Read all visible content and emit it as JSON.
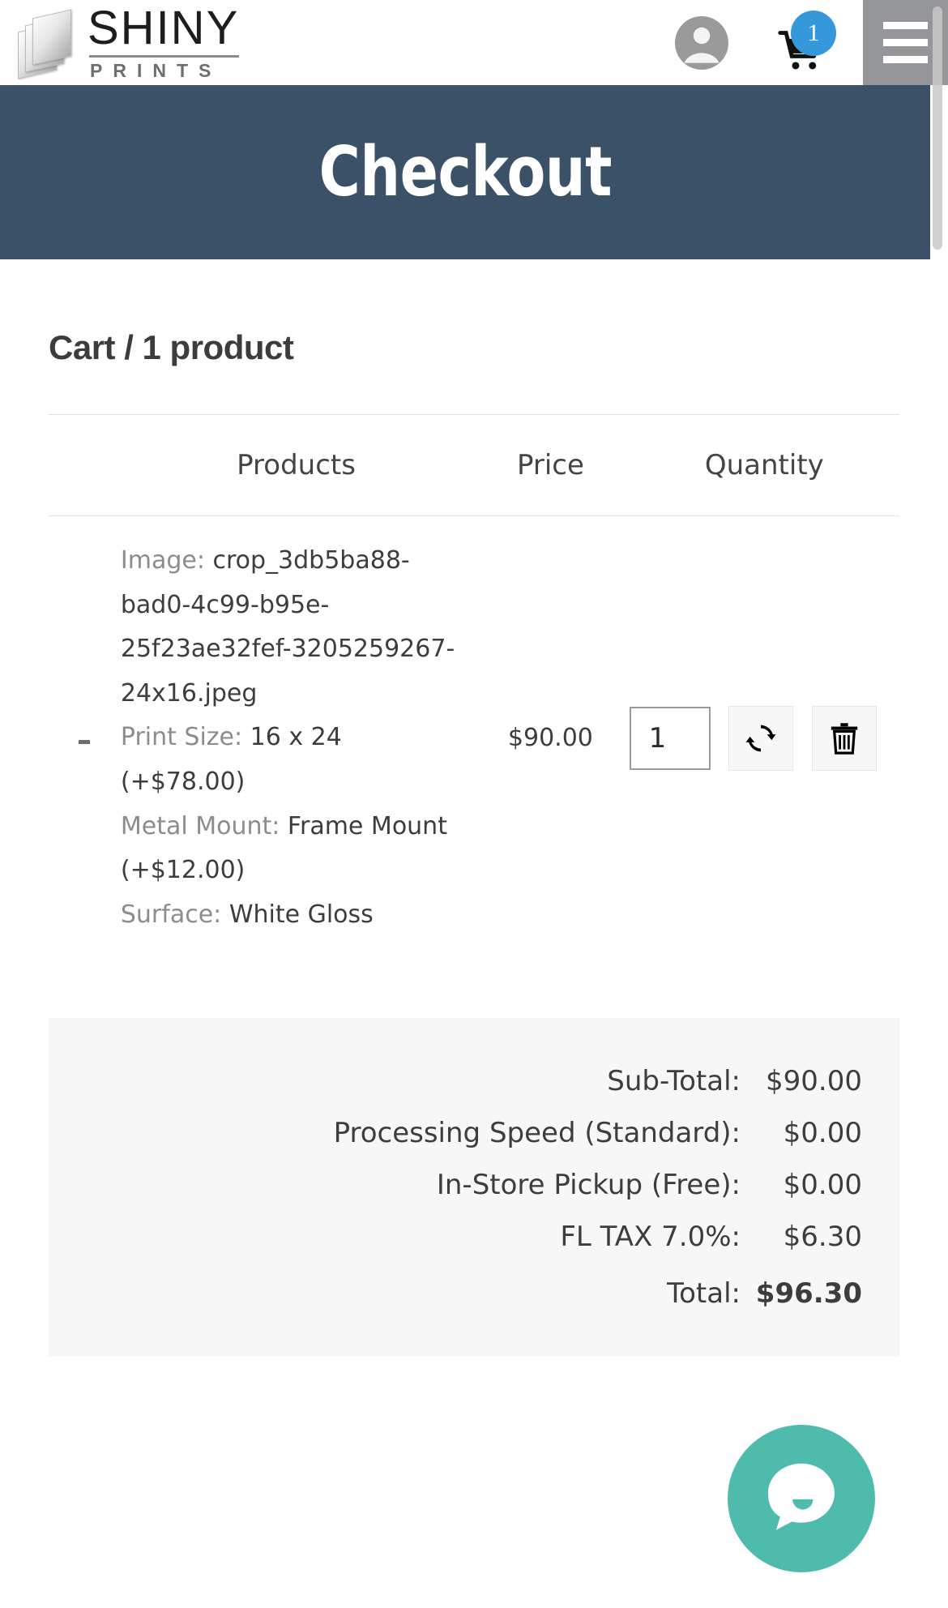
{
  "header": {
    "logo": {
      "primary": "SHINY",
      "secondary": "PRINTS",
      "icon": "stacked-prints-logo"
    },
    "account_icon": "account-circle-icon",
    "cart_icon": "shopping-cart-icon",
    "cart_count": "1",
    "menu_icon": "hamburger-menu-icon",
    "accent_badge_color": "#3498db",
    "menu_button_color": "#949699"
  },
  "banner": {
    "title": "Checkout",
    "background_color": "#3a5168"
  },
  "cart": {
    "heading": "Cart / 1 product",
    "columns": {
      "thumb": "",
      "products": "Products",
      "price": "Price",
      "quantity": "Quantity"
    },
    "items": [
      {
        "thumbnail_placeholder": "-",
        "attributes": [
          {
            "label": "Image:",
            "value": "crop_3db5ba88-bad0-4c99-b95e-25f23ae32fef-3205259267-24x16.jpeg"
          },
          {
            "label": "Print Size:",
            "value": "16 x 24 (+$78.00)"
          },
          {
            "label": "Metal Mount:",
            "value": "Frame Mount (+$12.00)"
          },
          {
            "label": "Surface:",
            "value": "White Gloss"
          }
        ],
        "price": "$90.00",
        "quantity": "1",
        "update_icon": "refresh-icon",
        "remove_icon": "trash-icon"
      }
    ]
  },
  "totals": {
    "rows": [
      {
        "label": "Sub-Total:",
        "value": "$90.00"
      },
      {
        "label": "Processing Speed (Standard):",
        "value": "$0.00"
      },
      {
        "label": "In-Store Pickup (Free):",
        "value": "$0.00"
      },
      {
        "label": "FL TAX 7.0%:",
        "value": "$6.30"
      }
    ],
    "grand": {
      "label": "Total:",
      "value": "$96.30"
    }
  },
  "chat": {
    "icon": "chat-bubble-icon",
    "color": "#4ebbad"
  }
}
